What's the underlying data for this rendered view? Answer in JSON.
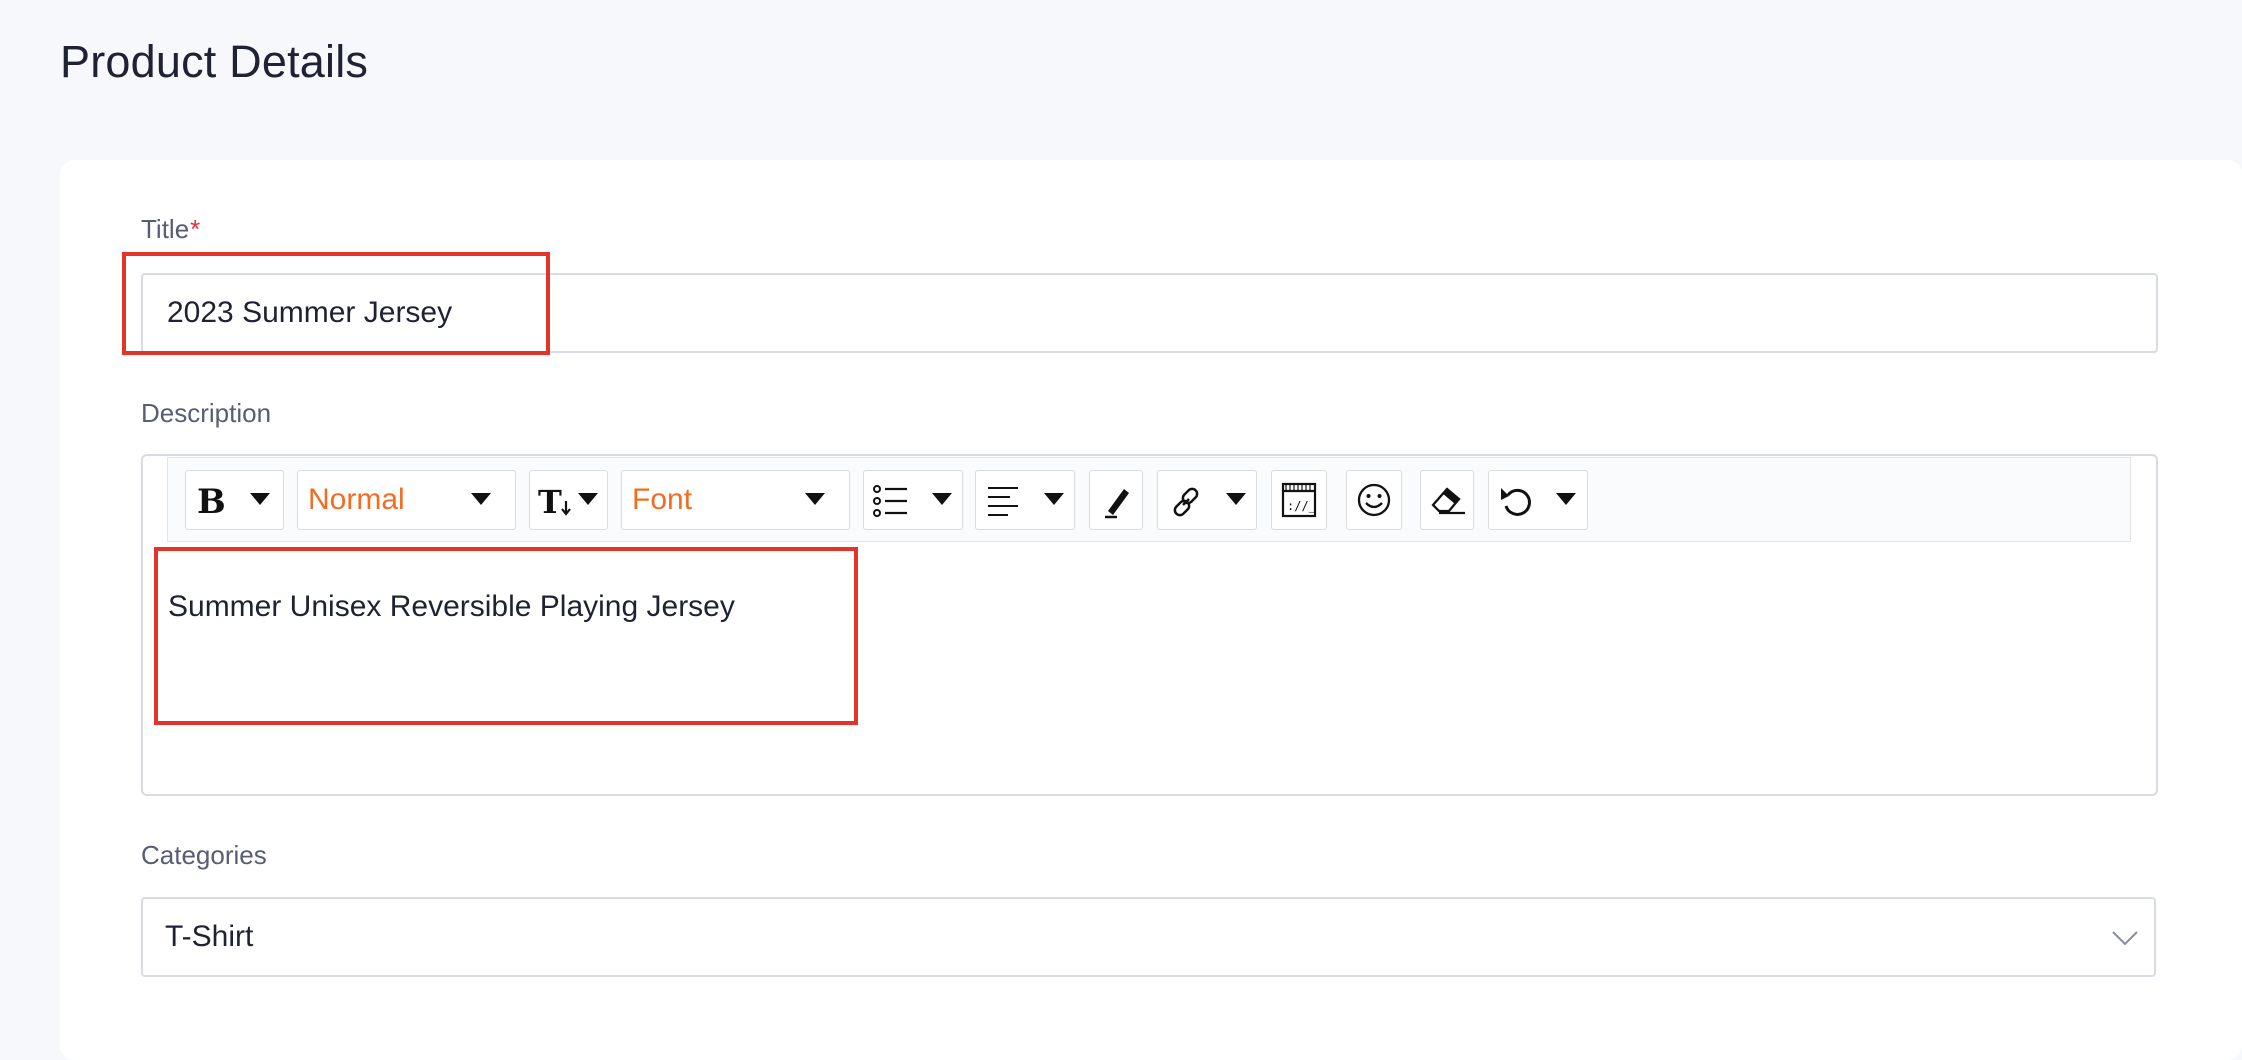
{
  "page": {
    "title": "Product Details"
  },
  "form": {
    "title_label": "Title",
    "title_required_mark": "*",
    "title_value": "2023 Summer Jersey",
    "description_label": "Description",
    "description_content": "Summer Unisex Reversible Playing Jersey",
    "categories_label": "Categories",
    "categories_value": "T-Shirt"
  },
  "toolbar": {
    "paragraph_style": "Normal",
    "font_family": "Font",
    "tools": [
      "bold-icon",
      "text-size-icon",
      "list-icon",
      "align-icon",
      "highlighter-icon",
      "link-icon",
      "code-view-icon",
      "emoji-icon",
      "eraser-icon",
      "undo-icon"
    ]
  },
  "colors": {
    "accent_text": "#f26d21",
    "annotation": "#e3342a",
    "required": "#e5303a"
  }
}
